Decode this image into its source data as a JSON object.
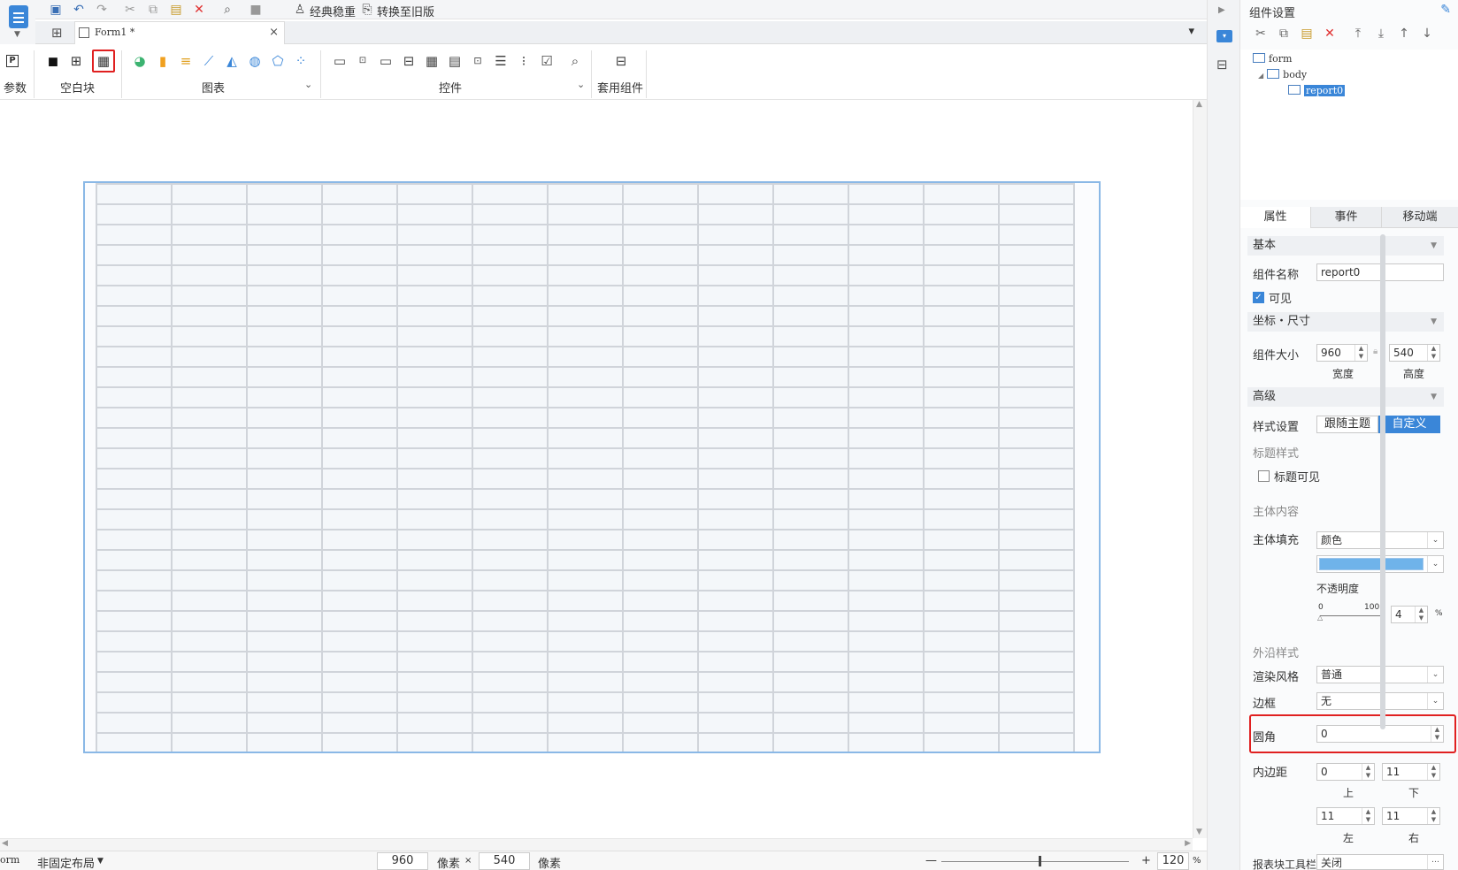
{
  "toolbar": {
    "theme_label": "经典稳重",
    "convert_label": "转换至旧版"
  },
  "tab": {
    "title": "Form1 *",
    "close": "×"
  },
  "ribbon": {
    "param_label": "参数",
    "blank_label": "空白块",
    "chart_label": "图表",
    "control_label": "控件",
    "template_label": "套用组件"
  },
  "status": {
    "form_label": "orm",
    "layout_label": "非固定布局",
    "width": "960",
    "unit1": "像素",
    "times": "×",
    "height": "540",
    "unit2": "像素",
    "minus": "—",
    "plus": "+",
    "zoom": "120",
    "percent": "%"
  },
  "panel": {
    "title": "组件设置",
    "tree": {
      "form": "form",
      "body": "body",
      "report": "report0"
    },
    "tabs": [
      "属性",
      "事件",
      "移动端"
    ],
    "basic": "基本",
    "name_label": "组件名称",
    "name_value": "report0",
    "visible_label": "可见",
    "coord_section": "坐标・尺寸",
    "size_label": "组件大小",
    "width_value": "960",
    "height_value": "540",
    "width_caption": "宽度",
    "height_caption": "高度",
    "advanced": "高级",
    "style_label": "样式设置",
    "style_follow": "跟随主题",
    "style_custom": "自定义",
    "title_style": "标题样式",
    "title_visible": "标题可见",
    "body_content": "主体内容",
    "body_fill": "主体填充",
    "fill_type": "颜色",
    "fill_color": "#6fb3ea",
    "opacity_label": "不透明度",
    "opacity_min": "0",
    "opacity_max": "100",
    "opacity_value": "4",
    "opacity_unit": "%",
    "border_style": "外沿样式",
    "render_label": "渲染风格",
    "render_value": "普通",
    "border_label": "边框",
    "border_value": "无",
    "radius_label": "圆角",
    "radius_value": "0",
    "padding_label": "内边距",
    "pad_top": "0",
    "pad_bottom": "11",
    "pad_left": "11",
    "pad_right": "11",
    "cap_top": "上",
    "cap_bottom": "下",
    "cap_left": "左",
    "cap_right": "右",
    "toolbar_label": "报表块工具栏",
    "toolbar_value": "关闭"
  }
}
